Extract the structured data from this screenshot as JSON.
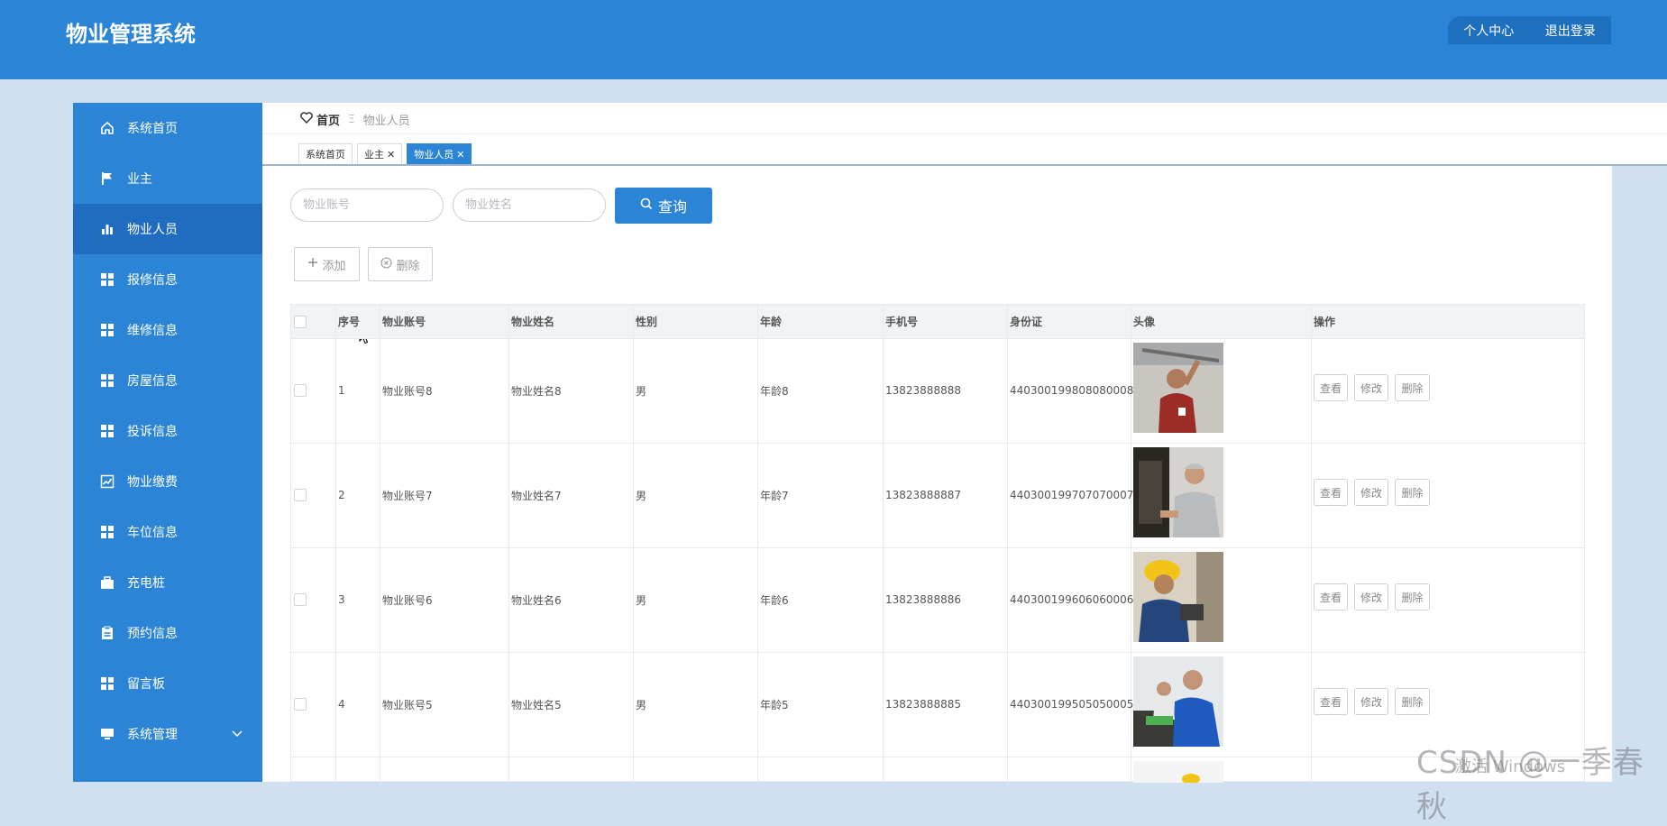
{
  "header": {
    "app_title": "物业管理系统",
    "user_center": "个人中心",
    "logout": "退出登录"
  },
  "sidebar": {
    "items": [
      {
        "label": "系统首页",
        "icon": "home-icon"
      },
      {
        "label": "业主",
        "icon": "flag-icon"
      },
      {
        "label": "物业人员",
        "icon": "bar-chart-icon"
      },
      {
        "label": "报修信息",
        "icon": "grid-icon"
      },
      {
        "label": "维修信息",
        "icon": "grid-icon"
      },
      {
        "label": "房屋信息",
        "icon": "grid-icon"
      },
      {
        "label": "投诉信息",
        "icon": "grid-icon"
      },
      {
        "label": "物业缴费",
        "icon": "line-chart-icon"
      },
      {
        "label": "车位信息",
        "icon": "grid-icon"
      },
      {
        "label": "充电桩",
        "icon": "briefcase-icon"
      },
      {
        "label": "预约信息",
        "icon": "clipboard-icon"
      },
      {
        "label": "留言板",
        "icon": "grid-icon"
      },
      {
        "label": "系统管理",
        "icon": "monitor-icon"
      }
    ],
    "active_index": 2
  },
  "breadcrumb": {
    "home": "首页",
    "separator": "Ξ",
    "current": "物业人员"
  },
  "tabs": [
    {
      "label": "系统首页",
      "closable": false
    },
    {
      "label": "业主",
      "closable": true
    },
    {
      "label": "物业人员",
      "closable": true
    }
  ],
  "search": {
    "account_placeholder": "物业账号",
    "name_placeholder": "物业姓名",
    "query_label": "查询"
  },
  "actions": {
    "add_label": "添加",
    "delete_label": "删除"
  },
  "table": {
    "columns": [
      "",
      "序号",
      "物业账号",
      "物业姓名",
      "性别",
      "年龄",
      "手机号",
      "身份证",
      "头像",
      "操作"
    ],
    "rows": [
      {
        "no": "1",
        "account": "物业账号8",
        "name": "物业姓名8",
        "gender": "男",
        "age": "年龄8",
        "phone": "13823888888",
        "id_card": "440300199808080008"
      },
      {
        "no": "2",
        "account": "物业账号7",
        "name": "物业姓名7",
        "gender": "男",
        "age": "年龄7",
        "phone": "13823888887",
        "id_card": "440300199707070007"
      },
      {
        "no": "3",
        "account": "物业账号6",
        "name": "物业姓名6",
        "gender": "男",
        "age": "年龄6",
        "phone": "13823888886",
        "id_card": "440300199606060006"
      },
      {
        "no": "4",
        "account": "物业账号5",
        "name": "物业姓名5",
        "gender": "男",
        "age": "年龄5",
        "phone": "13823888885",
        "id_card": "440300199505050005"
      }
    ],
    "row_actions": {
      "view": "查看",
      "edit": "修改",
      "delete": "删除"
    }
  },
  "overlay": {
    "watermark": "CSDN @一季春秋",
    "windows_activate": "激活 Windows"
  },
  "colors": {
    "primary": "#2b84d6",
    "sidebar_active": "#1f6cc0",
    "page_bg": "#cfe0f0"
  }
}
